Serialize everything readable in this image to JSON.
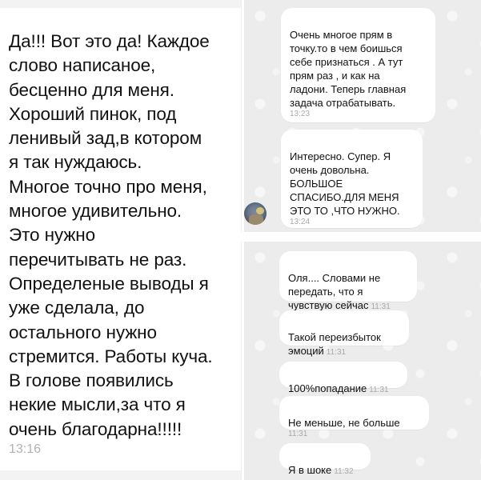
{
  "left_message": {
    "text": "Да!!! Вот это да! Каждое\nслово написаное,\nбесценно для меня.\nХороший пинок, под\nленивый зад,в котором\nя так нуждаюсь.\nМногое точно про меня,\nмногое удивительно.\nЭто нужно\nперечитывать не раз.\nОпределеные выводы я\nуже сделала, до\nостального нужно\nстремится. Работы куча.\nВ голове появились\nнекие мысли,за что я\nочень благодарна!!!!!",
    "time": "13:16"
  },
  "top_chat": {
    "messages": [
      {
        "text": "Очень многое прям в\nточку.то в чем боишься\nсебе признаться . А тут\nпрям раз , и как на\nладони. Теперь главная\nзадача отрабатывать.",
        "time": "13:23"
      },
      {
        "text": "Интересно. Супер. Я\nочень довольна.\nБОЛЬШОЕ\nСПАСИБО.ДЛЯ МЕНЯ\nЭТО ТО ,ЧТО НУЖНО.",
        "time": "13:24"
      }
    ]
  },
  "bottom_chat": {
    "messages": [
      {
        "text": "Оля.... Словами не\nпередать, что я\nчувствую сейчас",
        "time": "11:31"
      },
      {
        "text": "Такой переизбыток\nэмоций",
        "time": "11:31"
      },
      {
        "text": "100%попадание",
        "time": "11:31"
      },
      {
        "text": "Не меньше, не больше",
        "time": "11:31"
      },
      {
        "text": "Я в шоке",
        "time": "11:32"
      }
    ]
  },
  "colors": {
    "chat_background": "#ececec",
    "bubble": "#ffffff",
    "timestamp": "#a8a8a8"
  }
}
